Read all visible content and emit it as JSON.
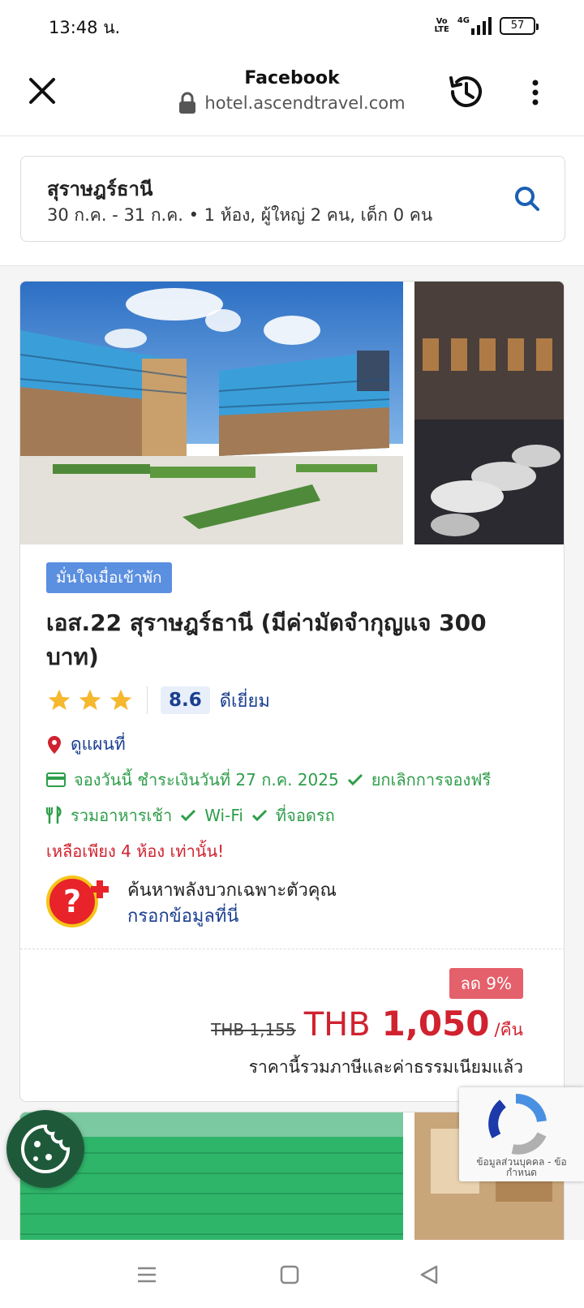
{
  "status_bar": {
    "time": "13:48 น.",
    "network_top": "Vo",
    "network_bottom": "LTE",
    "signal_label": "4G",
    "battery": "57"
  },
  "browser": {
    "title": "Facebook",
    "url": "hotel.ascendtravel.com",
    "icons": [
      "close-icon",
      "lock-icon",
      "history-icon",
      "more-vertical-icon"
    ]
  },
  "search": {
    "destination": "สุราษฎร์ธานี",
    "details": "30 ก.ค. - 31 ก.ค.  •  1 ห้อง, ผู้ใหญ่ 2 คน, เด็ก 0 คน"
  },
  "hotel": {
    "badge": "มั่นใจเมื่อเข้าพัก",
    "name": "เอส.22 สุราษฎร์ธานี (มีค่ามัดจำกุญแจ 300 บาท)",
    "stars": 3,
    "score": "8.6",
    "score_label": "ดีเยี่ยม",
    "map_link": "ดูแผนที่",
    "pay_info": "จองวันนี้ ชำระเงินวันที่ 27 ก.ค. 2025",
    "cancel_info": "ยกเลิกการจองฟรี",
    "amenity_breakfast": "รวมอาหารเช้า",
    "amenity_wifi": "Wi-Fi",
    "amenity_parking": "ที่จอดรถ",
    "remaining": "เหลือเพียง 4 ห้อง เท่านั้น!",
    "promo_title": "ค้นหาพลังบวกเฉพาะตัวคุณ",
    "promo_link": "กรอกข้อมูลที่นี่",
    "discount": "ลด 9%",
    "old_price": "THB 1,155",
    "currency": "THB",
    "price": "1,050",
    "per_night": "/คืน",
    "tax_note": "ราคานี้รวมภาษีและค่าธรรมเนียมแล้ว"
  },
  "recaptcha": {
    "text": "ข้อมูลส่วนบุคคล - ข้อกำหนด"
  },
  "colors": {
    "brand_blue": "#1a3f8f",
    "green": "#2e9e4a",
    "red": "#d0222f",
    "badge_blue": "#5b8fe0",
    "discount_red": "#e4606b"
  }
}
